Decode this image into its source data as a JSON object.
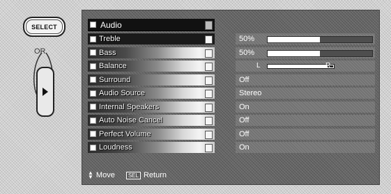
{
  "remote": {
    "select_label": "SELECT",
    "or_label": "OR"
  },
  "menu": {
    "title": "Audio",
    "items": [
      {
        "label": "Treble",
        "value": "50%",
        "level": 50,
        "kind": "bar",
        "selected": true
      },
      {
        "label": "Bass",
        "value": "50%",
        "level": 50,
        "kind": "bar"
      },
      {
        "label": "Balance",
        "value": "",
        "kind": "balance",
        "left": "L",
        "right": "R"
      },
      {
        "label": "Surround",
        "value": "Off",
        "kind": "text"
      },
      {
        "label": "Audio Source",
        "value": "Stereo",
        "kind": "text"
      },
      {
        "label": "Internal Speakers",
        "value": "On",
        "kind": "text"
      },
      {
        "label": "Auto Noise Cancel",
        "value": "Off",
        "kind": "text"
      },
      {
        "label": "Perfect Volume",
        "value": "Off",
        "kind": "text"
      },
      {
        "label": "Loudness",
        "value": "On",
        "kind": "text"
      }
    ],
    "footer": {
      "move_label": "Move",
      "sel_key": "SEL",
      "return_label": "Return"
    }
  },
  "colors": {
    "panel_bg": "#6a6a6a",
    "row_selected": "#1a1a1a",
    "bar_fill": "#ffffff"
  }
}
